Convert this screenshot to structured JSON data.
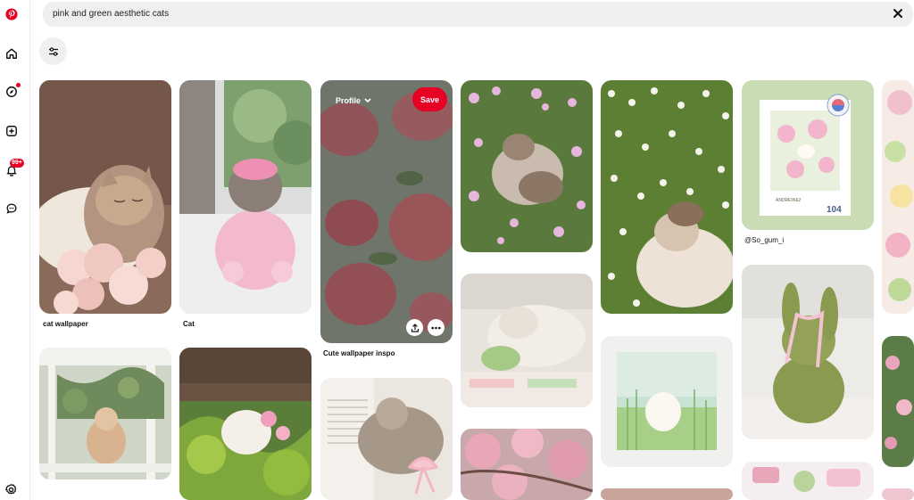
{
  "search": {
    "query": "pink and green aesthetic cats"
  },
  "notifications": {
    "count": "99+"
  },
  "pins": [
    {
      "id": "cat-wallpaper",
      "caption": "cat wallpaper"
    },
    {
      "id": "cat",
      "caption": "Cat"
    },
    {
      "id": "cute-wallpaper-inspo",
      "caption": "Cute wallpaper inspo",
      "profile_label": "Profile",
      "save_label": "Save"
    },
    {
      "id": "so-gum",
      "caption": "@So_gum_i",
      "stamp_text": "104",
      "stamp_small": "ANDREW&2"
    }
  ],
  "colors": {
    "brand": "#e60023",
    "search_bg": "#efefef"
  }
}
